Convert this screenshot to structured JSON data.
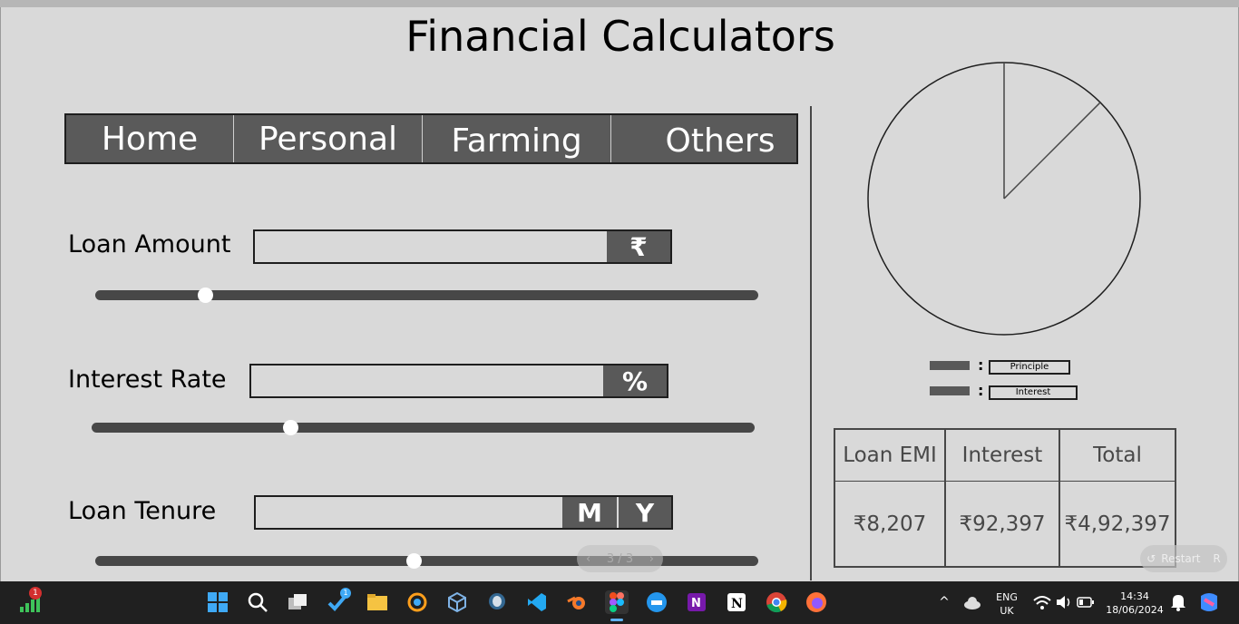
{
  "title": "Financial Calculators",
  "tabs": [
    "Home",
    "Personal",
    "Farming",
    "Others"
  ],
  "loan_amount": {
    "label": "Loan Amount",
    "value": "",
    "unit": "₹",
    "slider_fraction": 0.165
  },
  "interest_rate": {
    "label": "Interest Rate",
    "value": "",
    "unit": "%",
    "slider_fraction": 0.3
  },
  "loan_tenure": {
    "label": "Loan Tenure",
    "value": "",
    "unit_month": "M",
    "unit_year": "Y",
    "slider_fraction": 0.48
  },
  "pie": {
    "principal_fraction": 0.875,
    "interest_fraction": 0.125
  },
  "legend": {
    "principle": "Principle",
    "interest": "Interest"
  },
  "results": {
    "headers": [
      "Loan EMI",
      "Interest",
      "Total"
    ],
    "values": [
      "₹8,207",
      "₹92,397",
      "₹4,92,397"
    ]
  },
  "presentation": {
    "pager": "3 / 3",
    "restart": "Restart",
    "restart_key": "R"
  },
  "taskbar": {
    "notification_count": "1",
    "app_badge_count": "1",
    "language": "ENG",
    "region": "UK",
    "time": "14:34",
    "date": "18/06/2024"
  },
  "colors": {
    "background": "#d9d9d9",
    "dark": "#595959",
    "taskbar": "#202020"
  }
}
